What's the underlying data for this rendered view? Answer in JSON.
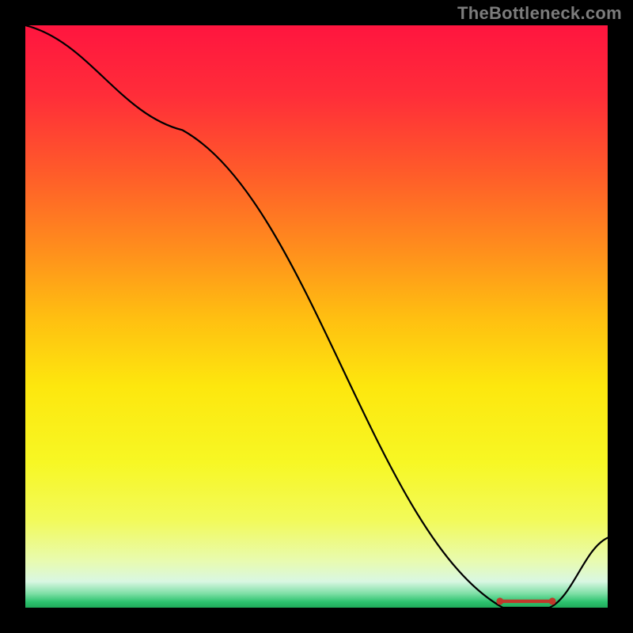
{
  "watermark": "TheBottleneck.com",
  "chart_data": {
    "type": "line",
    "title": "",
    "xlabel": "",
    "ylabel": "",
    "x": [
      0.0,
      0.27,
      0.82,
      0.9,
      1.0
    ],
    "y": [
      1.0,
      0.82,
      0.0,
      0.0,
      0.12
    ],
    "xlim": [
      0,
      1
    ],
    "ylim": [
      0,
      1
    ],
    "background_gradient_stops": [
      {
        "offset": 0.0,
        "color": "#ff153f"
      },
      {
        "offset": 0.12,
        "color": "#ff2d39"
      },
      {
        "offset": 0.25,
        "color": "#ff5a2a"
      },
      {
        "offset": 0.38,
        "color": "#ff8c1d"
      },
      {
        "offset": 0.5,
        "color": "#ffbe11"
      },
      {
        "offset": 0.62,
        "color": "#fde70e"
      },
      {
        "offset": 0.75,
        "color": "#f7f724"
      },
      {
        "offset": 0.85,
        "color": "#f2fa5a"
      },
      {
        "offset": 0.92,
        "color": "#e8fbb0"
      },
      {
        "offset": 0.955,
        "color": "#d9f7e2"
      },
      {
        "offset": 0.975,
        "color": "#82e0a9"
      },
      {
        "offset": 0.99,
        "color": "#2dc36f"
      },
      {
        "offset": 1.0,
        "color": "#1faa59"
      }
    ],
    "marker_cluster": {
      "y": 0.011,
      "x_start": 0.815,
      "x_end": 0.905,
      "color": "#c0392b"
    }
  }
}
